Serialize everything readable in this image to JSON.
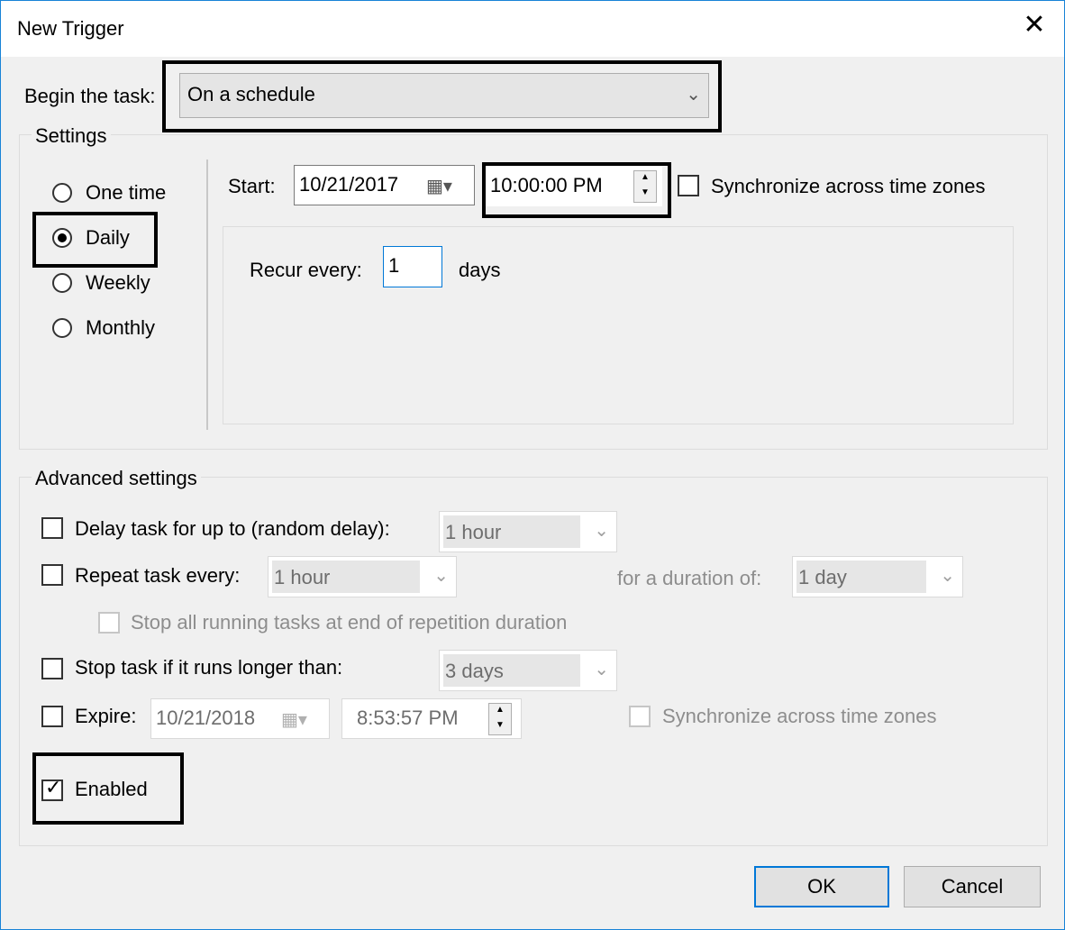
{
  "window": {
    "title": "New Trigger",
    "close_glyph": "✕"
  },
  "begin": {
    "label": "Begin the task:",
    "value": "On a schedule"
  },
  "settings": {
    "group_label": "Settings",
    "options": [
      "One time",
      "Daily",
      "Weekly",
      "Monthly"
    ],
    "selected": "Daily",
    "start_label": "Start:",
    "start_date": "10/21/2017",
    "start_time": "10:00:00 PM",
    "sync_label": "Synchronize across time zones",
    "recur_label": "Recur every:",
    "recur_value": "1",
    "recur_unit": "days"
  },
  "advanced": {
    "group_label": "Advanced settings",
    "delay_label": "Delay task for up to (random delay):",
    "delay_value": "1 hour",
    "repeat_label": "Repeat task every:",
    "repeat_value": "1 hour",
    "duration_label": "for a duration of:",
    "duration_value": "1 day",
    "stop_all_label": "Stop all running tasks at end of repetition duration",
    "stop_longer_label": "Stop task if it runs longer than:",
    "stop_longer_value": "3 days",
    "expire_label": "Expire:",
    "expire_date": "10/21/2018",
    "expire_time": "8:53:57 PM",
    "expire_sync_label": "Synchronize across time zones",
    "enabled_label": "Enabled",
    "enabled_checked": true
  },
  "buttons": {
    "ok": "OK",
    "cancel": "Cancel"
  }
}
